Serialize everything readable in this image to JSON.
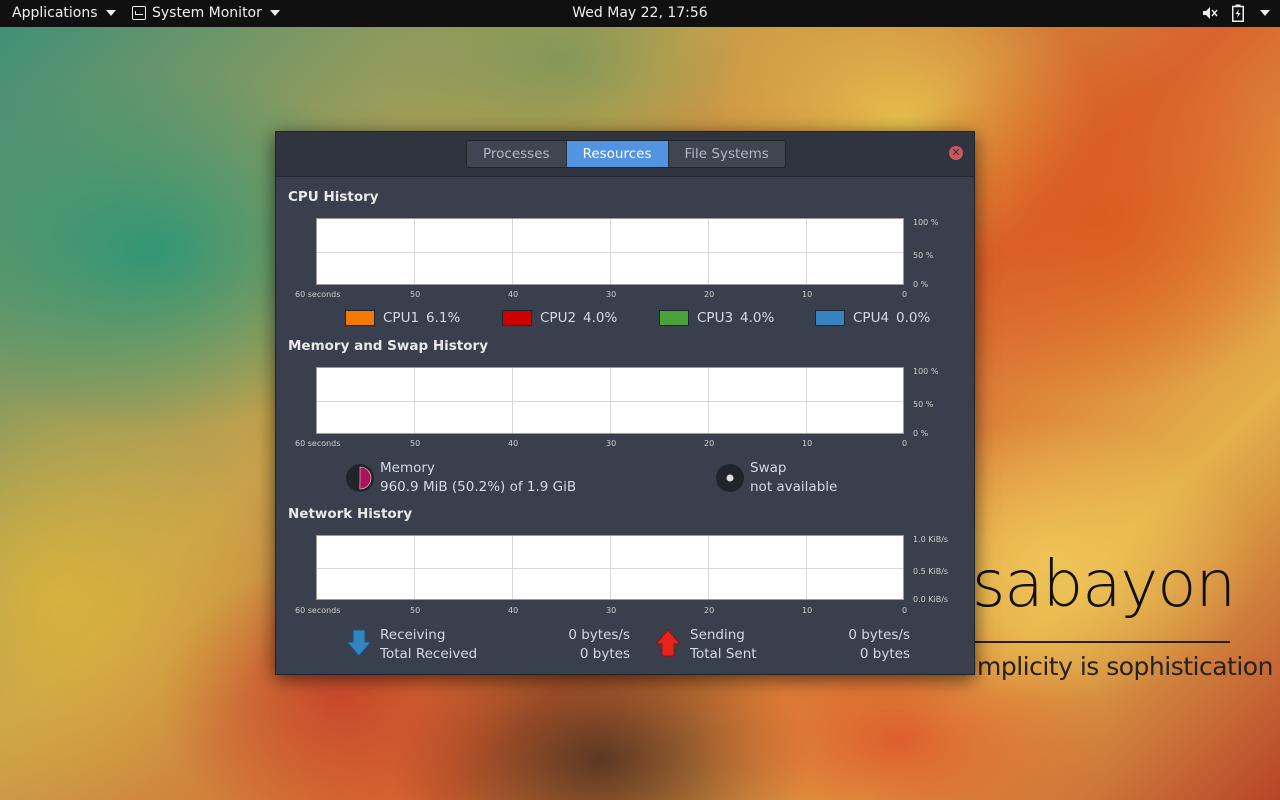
{
  "topbar": {
    "applications": "Applications",
    "app_menu": "System Monitor",
    "clock": "Wed May 22, 17:56",
    "icons": [
      "speaker-muted-icon",
      "battery-icon",
      "system-menu-caret-icon"
    ]
  },
  "window": {
    "tabs": [
      {
        "label": "Processes",
        "active": false
      },
      {
        "label": "Resources",
        "active": true
      },
      {
        "label": "File Systems",
        "active": false
      }
    ],
    "x_ticks": [
      "60 seconds",
      "50",
      "40",
      "30",
      "20",
      "10",
      "0"
    ],
    "cpu": {
      "title": "CPU History",
      "y_ticks": [
        "100 %",
        "50 %",
        "0 %"
      ],
      "legend": [
        {
          "name": "CPU1",
          "value": "6.1%",
          "color": "#f57900"
        },
        {
          "name": "CPU2",
          "value": "4.0%",
          "color": "#cc0000"
        },
        {
          "name": "CPU3",
          "value": "4.0%",
          "color": "#4aa13a"
        },
        {
          "name": "CPU4",
          "value": "0.0%",
          "color": "#3583c0"
        }
      ]
    },
    "memory": {
      "title": "Memory and Swap History",
      "y_ticks": [
        "100 %",
        "50 %",
        "0 %"
      ],
      "mem_label": "Memory",
      "mem_value": "960.9 MiB (50.2%) of 1.9 GiB",
      "mem_fraction": 0.502,
      "mem_color": "#ad1457",
      "swap_label": "Swap",
      "swap_value": "not available"
    },
    "network": {
      "title": "Network History",
      "y_ticks": [
        "1.0 KiB/s",
        "0.5 KiB/s",
        "0.0 KiB/s"
      ],
      "receiving_label": "Receiving",
      "total_received_label": "Total Received",
      "receiving_value": "0 bytes/s",
      "total_received_value": "0 bytes",
      "sending_label": "Sending",
      "total_sent_label": "Total Sent",
      "sending_value": "0 bytes/s",
      "total_sent_value": "0 bytes",
      "receive_color": "#3583c0",
      "send_color": "#e8231b"
    }
  },
  "wallpaper": {
    "brand": "sabayon",
    "tagline": "simplicity is sophistication"
  }
}
